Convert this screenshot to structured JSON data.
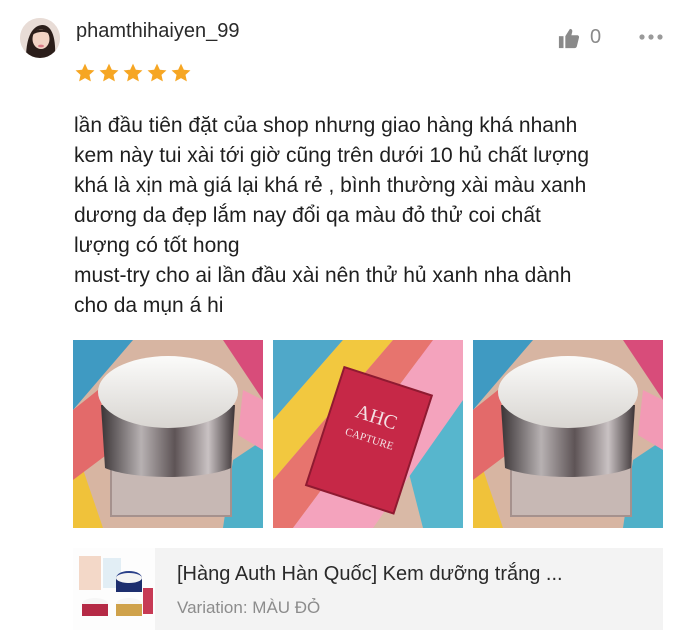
{
  "review": {
    "username": "phamthihaiyen_99",
    "rating": 5,
    "like_count": "0",
    "text_lines": [
      "lần đầu tiên đặt của shop nhưng giao hàng khá nhanh",
      "kem này tui xài tới giờ cũng trên dưới 10 hủ chất lượng",
      "khá là xịn mà giá lại khá rẻ , bình thường xài màu xanh",
      "dương da đẹp lắm nay đổi qa màu đỏ thử coi chất",
      "lượng có tốt hong",
      "must-try cho ai lần đầu xài nên thử hủ xanh nha dành",
      "cho da mụn á hi"
    ],
    "photos": [
      {
        "label": "",
        "subject": "cream-jar-lid"
      },
      {
        "label": "AHC",
        "subject": "ahc-box",
        "box_text": "CAPTURE"
      },
      {
        "label": "",
        "subject": "cream-jar-lid"
      }
    ]
  },
  "product": {
    "title": "[Hàng Auth Hàn Quốc] Kem dưỡng trắng ...",
    "variation": "Variation: MÀU ĐỎ"
  },
  "colors": {
    "star": "#f6a623",
    "icon_grey": "#8a8a8a",
    "card_bg": "#f3f3f3"
  },
  "icons": {
    "like": "thumbs-up-icon",
    "more": "more-dots-icon",
    "star": "star-icon"
  }
}
